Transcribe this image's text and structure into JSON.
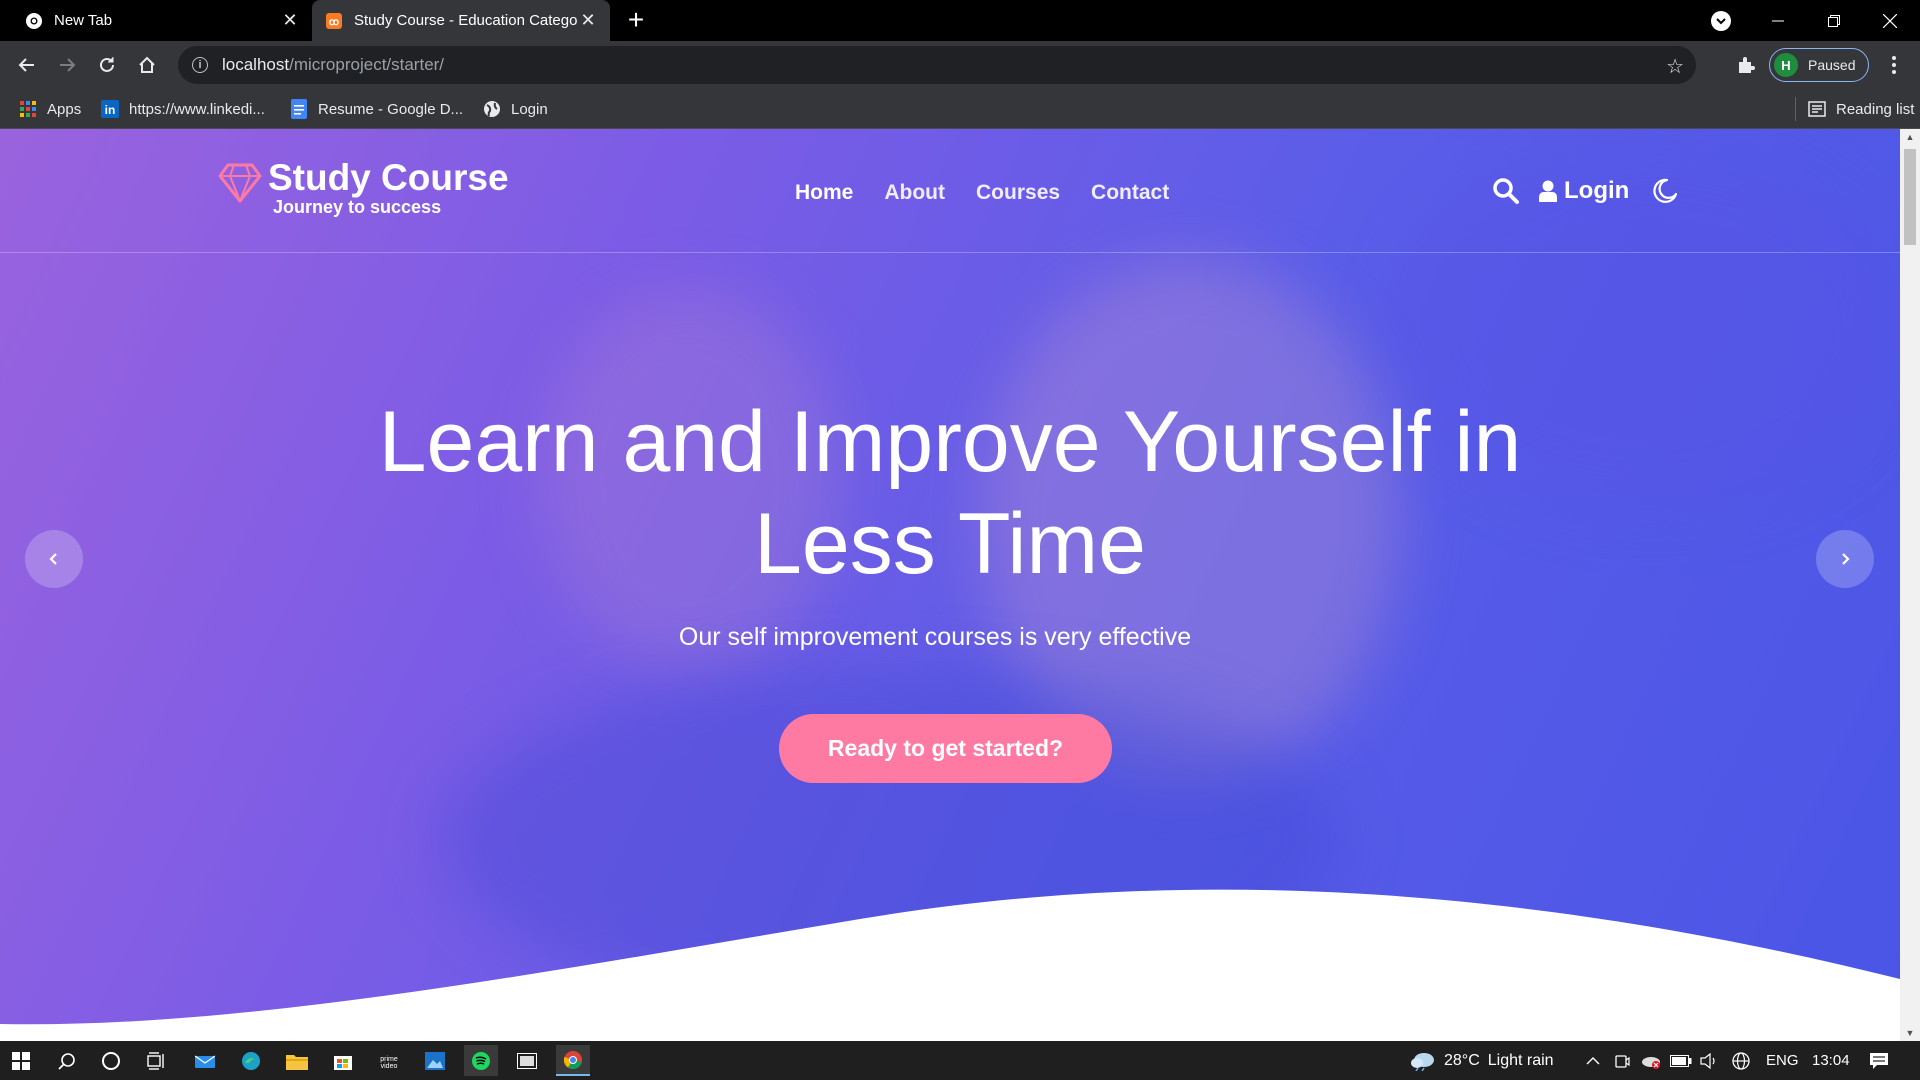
{
  "browser": {
    "tabs": [
      {
        "title": "New Tab",
        "active": false
      },
      {
        "title": "Study Course - Education Category",
        "active": true
      }
    ],
    "address": {
      "host": "localhost",
      "path": "/microproject/starter/"
    },
    "profile": {
      "initial": "H",
      "status": "Paused"
    },
    "bookmarks": [
      {
        "label": "Apps",
        "icon": "apps-grid-icon"
      },
      {
        "label": "https://www.linkedi...",
        "icon": "linkedin-icon"
      },
      {
        "label": "Resume - Google D...",
        "icon": "google-docs-icon"
      },
      {
        "label": "Login",
        "icon": "globe-icon"
      }
    ],
    "reading_list": "Reading list"
  },
  "site": {
    "brand": "Study Course",
    "tagline": "Journey to success",
    "nav": [
      "Home",
      "About",
      "Courses",
      "Contact"
    ],
    "login_label": "Login",
    "hero": {
      "title": "Learn and Improve Yourself in Less Time",
      "subtitle": "Our self improvement courses is very effective",
      "cta": "Ready to get started?"
    },
    "colors": {
      "accent": "#ff7aa2",
      "gradient_start": "#9a63de",
      "gradient_end": "#4a55e6"
    }
  },
  "taskbar": {
    "weather": {
      "temp": "28°C",
      "condition": "Light rain"
    },
    "language": "ENG",
    "time": "13:04"
  }
}
